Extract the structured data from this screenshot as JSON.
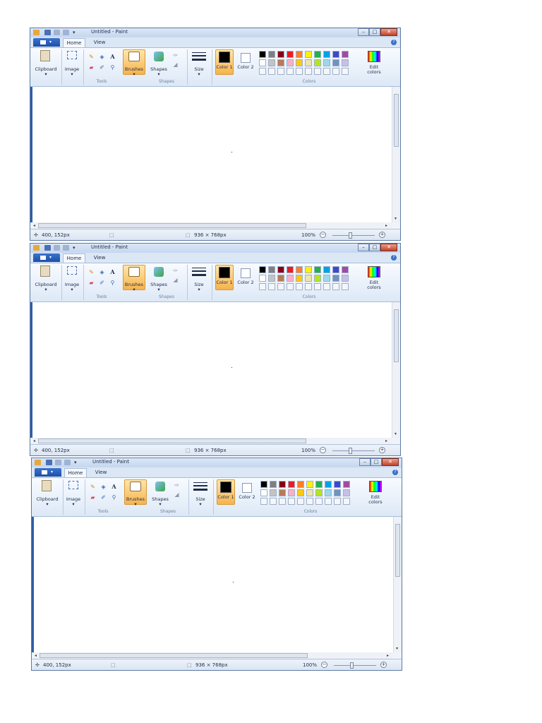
{
  "windows": [
    {
      "title": "Untitled - Paint",
      "tabs": [
        "Home",
        "View"
      ],
      "ribbon": {
        "clipboard": "Clipboard",
        "image": "Image",
        "tools_group": "Tools",
        "brushes": "Brushes",
        "shapes": "Shapes",
        "shapes_group": "Shapes",
        "size": "Size",
        "color1": "Color 1",
        "color2": "Color 2",
        "colors_group": "Colors",
        "edit_colors": "Edit colors"
      },
      "status": {
        "cursor": "400, 152px",
        "canvas_size": "936 × 768px",
        "zoom": "100%"
      }
    },
    {
      "title": "Untitled - Paint",
      "tabs": [
        "Home",
        "View"
      ],
      "ribbon": {
        "clipboard": "Clipboard",
        "image": "Image",
        "tools_group": "Tools",
        "brushes": "Brushes",
        "shapes": "Shapes",
        "shapes_group": "Shapes",
        "size": "Size",
        "color1": "Color 1",
        "color2": "Color 2",
        "colors_group": "Colors",
        "edit_colors": "Edit colors"
      },
      "status": {
        "cursor": "400, 152px",
        "canvas_size": "936 × 768px",
        "zoom": "100%"
      }
    },
    {
      "title": "Untitled - Paint",
      "tabs": [
        "Home",
        "View"
      ],
      "ribbon": {
        "clipboard": "Clipboard",
        "image": "Image",
        "tools_group": "Tools",
        "brushes": "Brushes",
        "shapes": "Shapes",
        "shapes_group": "Shapes",
        "size": "Size",
        "color1": "Color 1",
        "color2": "Color 2",
        "colors_group": "Colors",
        "edit_colors": "Edit colors"
      },
      "status": {
        "cursor": "400, 152px",
        "canvas_size": "936 × 768px",
        "zoom": "100%"
      }
    }
  ],
  "palette_row1": [
    "#000000",
    "#7f7f7f",
    "#880015",
    "#ed1c24",
    "#ff7f27",
    "#fff200",
    "#22b14c",
    "#00a2e8",
    "#3f48cc",
    "#a349a4"
  ],
  "palette_row2": [
    "#ffffff",
    "#c3c3c3",
    "#b97a57",
    "#ffaec9",
    "#ffc90e",
    "#efe4b0",
    "#b5e61d",
    "#99d9ea",
    "#7092be",
    "#c8bfe7"
  ],
  "colors": {
    "accent": "#3a73cf",
    "selected_tool": "#fbc56a",
    "color1": "#000000",
    "color2": "#ffffff"
  },
  "icons": [
    "paint-icon",
    "save-icon",
    "undo-icon",
    "redo-icon",
    "pencil-icon",
    "fill-icon",
    "text-icon",
    "eraser-icon",
    "picker-icon",
    "magnifier-icon",
    "brush-icon",
    "shapes-icon",
    "size-icon",
    "edit-colors-icon",
    "cursor-icon",
    "selection-icon",
    "canvas-size-icon",
    "zoom-out-icon",
    "zoom-in-icon",
    "help-icon"
  ]
}
